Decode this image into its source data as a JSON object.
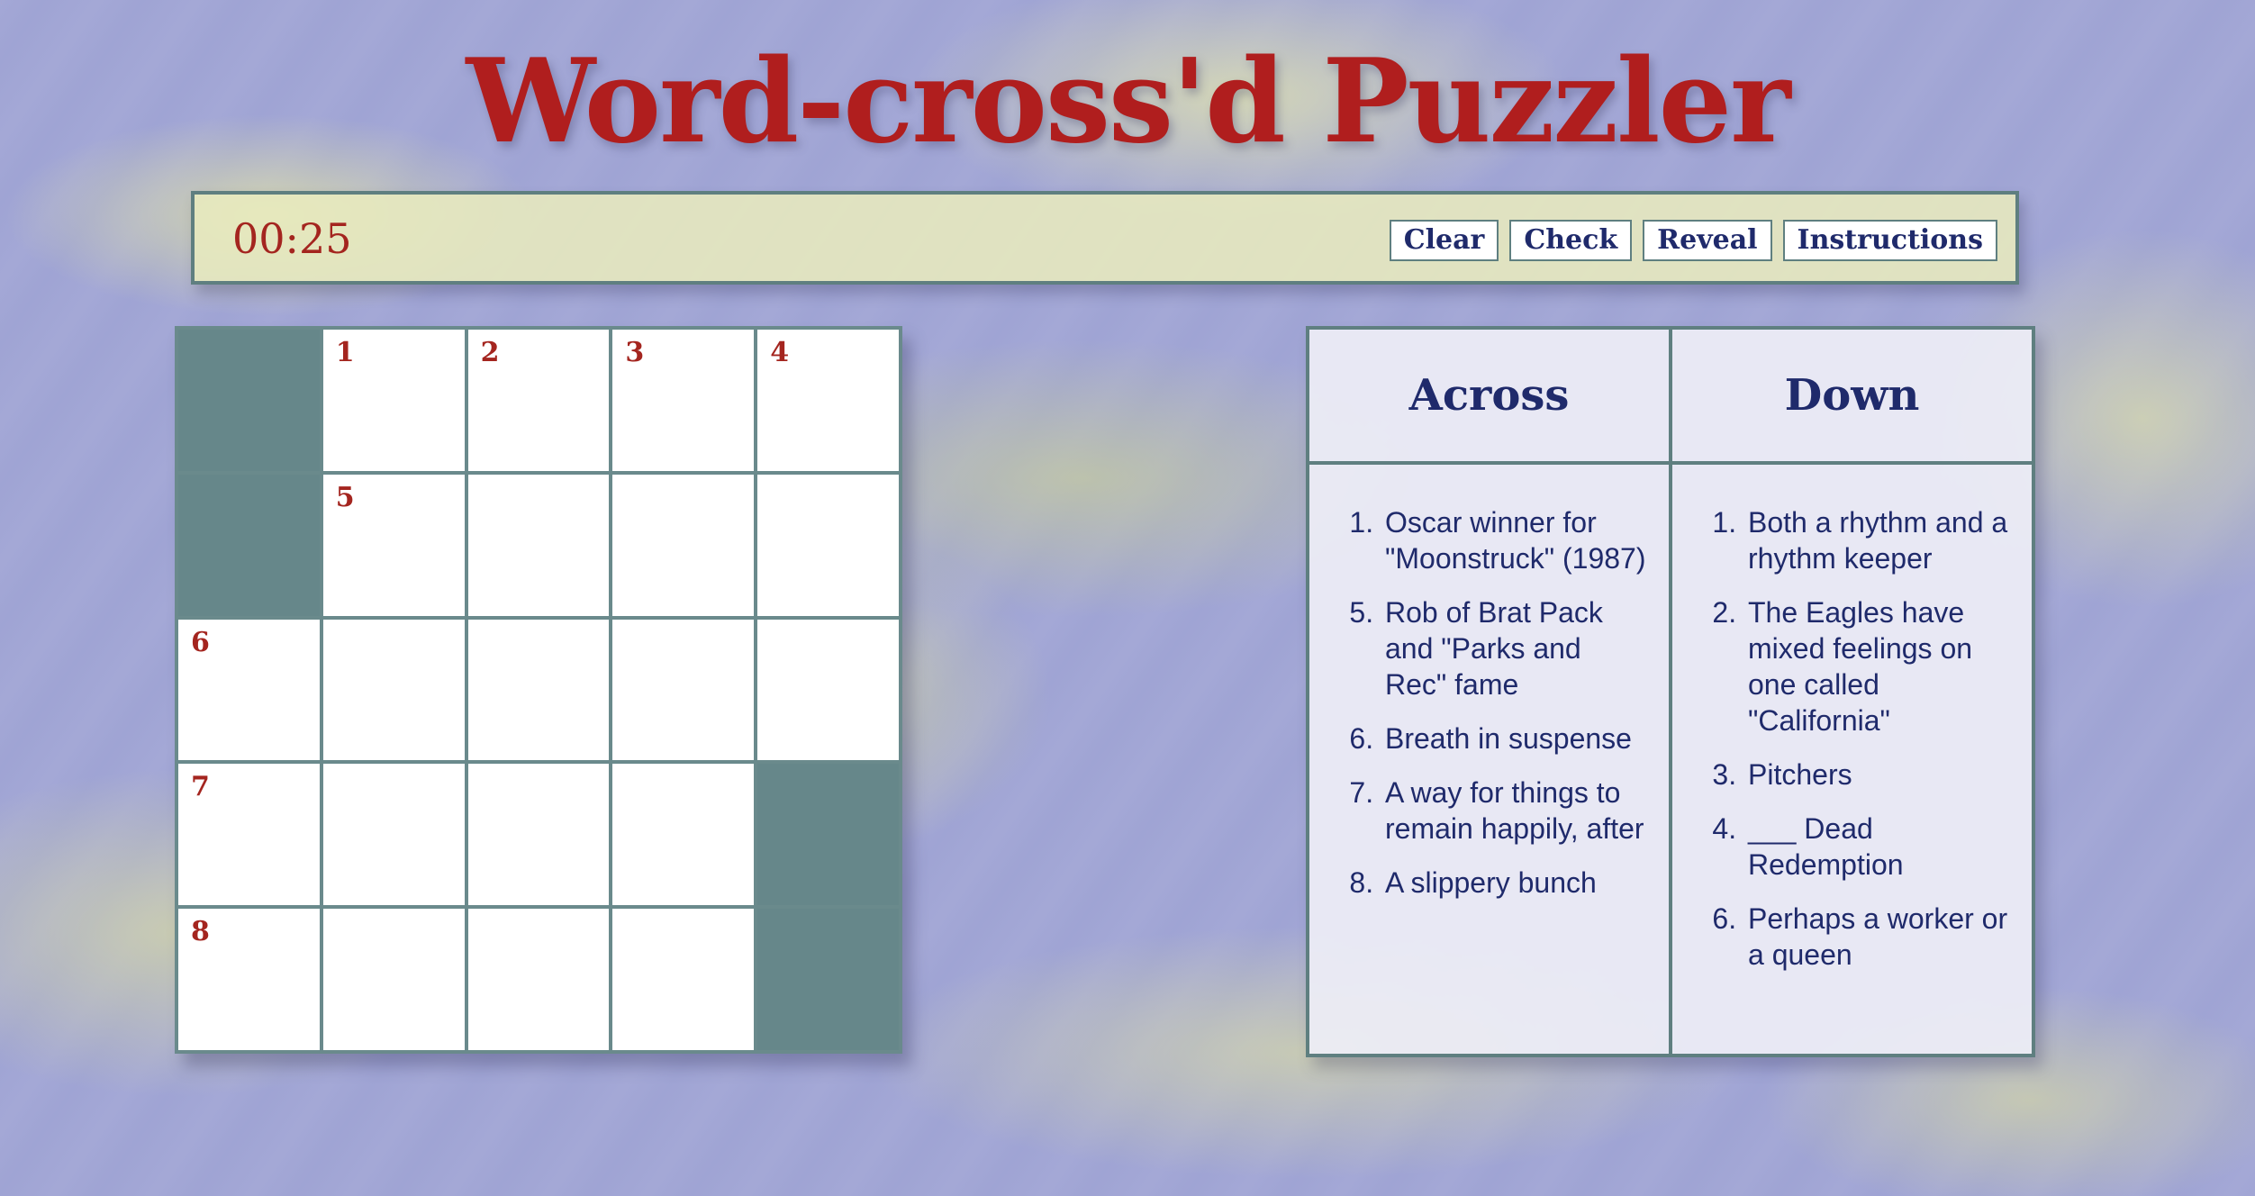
{
  "header": {
    "title": "Word-cross'd Puzzler"
  },
  "toolbar": {
    "timer": "00:25",
    "buttons": {
      "clear": "Clear",
      "check": "Check",
      "reveal": "Reveal",
      "instructions": "Instructions"
    }
  },
  "grid": {
    "rows": 5,
    "cols": 5,
    "cells": [
      {
        "block": true,
        "number": ""
      },
      {
        "block": false,
        "number": "1"
      },
      {
        "block": false,
        "number": "2"
      },
      {
        "block": false,
        "number": "3"
      },
      {
        "block": false,
        "number": "4"
      },
      {
        "block": true,
        "number": ""
      },
      {
        "block": false,
        "number": "5"
      },
      {
        "block": false,
        "number": ""
      },
      {
        "block": false,
        "number": ""
      },
      {
        "block": false,
        "number": ""
      },
      {
        "block": false,
        "number": "6"
      },
      {
        "block": false,
        "number": ""
      },
      {
        "block": false,
        "number": ""
      },
      {
        "block": false,
        "number": ""
      },
      {
        "block": false,
        "number": ""
      },
      {
        "block": false,
        "number": "7"
      },
      {
        "block": false,
        "number": ""
      },
      {
        "block": false,
        "number": ""
      },
      {
        "block": false,
        "number": ""
      },
      {
        "block": true,
        "number": ""
      },
      {
        "block": false,
        "number": "8"
      },
      {
        "block": false,
        "number": ""
      },
      {
        "block": false,
        "number": ""
      },
      {
        "block": false,
        "number": ""
      },
      {
        "block": true,
        "number": ""
      }
    ]
  },
  "clues": {
    "across_title": "Across",
    "down_title": "Down",
    "across": [
      {
        "num": 1,
        "text": "Oscar winner for \"Moonstruck\" (1987)"
      },
      {
        "num": 5,
        "text": "Rob of Brat Pack and \"Parks and Rec\" fame"
      },
      {
        "num": 6,
        "text": "Breath in suspense"
      },
      {
        "num": 7,
        "text": "A way for things to remain happily, after"
      },
      {
        "num": 8,
        "text": "A slippery bunch"
      }
    ],
    "down": [
      {
        "num": 1,
        "text": "Both a rhythm and a rhythm keeper"
      },
      {
        "num": 2,
        "text": "The Eagles have mixed feelings on one called \"California\""
      },
      {
        "num": 3,
        "text": "Pitchers"
      },
      {
        "num": 4,
        "text": "___ Dead Redemption"
      },
      {
        "num": 6,
        "text": "Perhaps a worker or a queen"
      }
    ]
  },
  "colors": {
    "accent_red": "#b01e1e",
    "navy": "#1f2a6b",
    "teal_border": "#5f7f80",
    "block": "#66878a"
  }
}
